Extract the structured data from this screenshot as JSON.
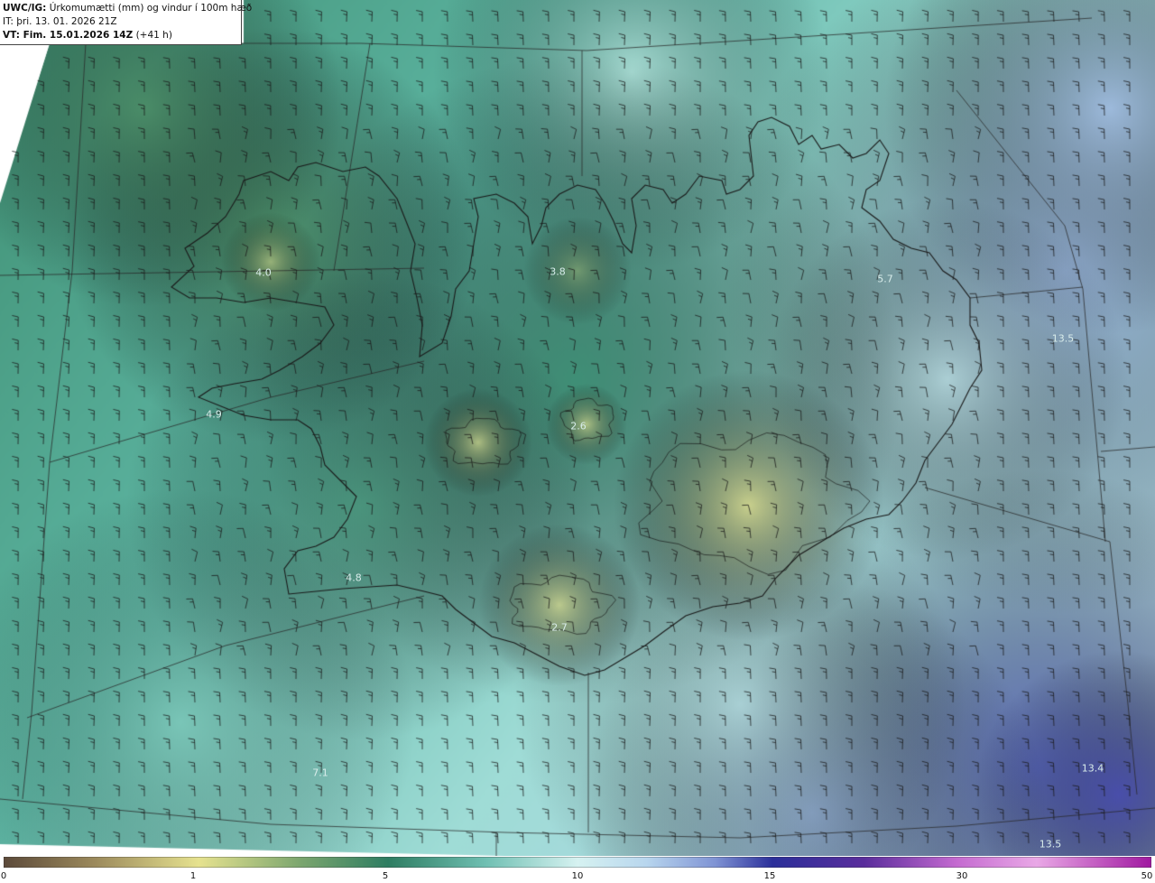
{
  "header": {
    "model_label": "UWC/IG:",
    "title": "Úrkomumætti (mm) og vindur í 100m hæð",
    "it_label": "IT:",
    "it_value": "þri. 13. 01. 2026 21Z",
    "vt_label": "VT: Fim. 15.01.2026 14Z",
    "vt_offset": "(+41 h)"
  },
  "map": {
    "point_labels": [
      "4.0",
      "3.8",
      "5.7",
      "13.5",
      "4.9",
      "2.6",
      "4.8",
      "2.7",
      "7.1",
      "13.4",
      "13.5"
    ]
  },
  "colorbar": {
    "ticks": [
      "0",
      "1",
      "5",
      "10",
      "15",
      "30",
      "50"
    ],
    "colors": [
      "#5c4a3a",
      "#b8a56a",
      "#e6e28f",
      "#6e9f6b",
      "#2e7d62",
      "#6fbfb2",
      "#cdeff0",
      "#c2dcef",
      "#7f93d4",
      "#2b2f9a",
      "#8a3aa8",
      "#e39ae0",
      "#a018a0"
    ]
  }
}
